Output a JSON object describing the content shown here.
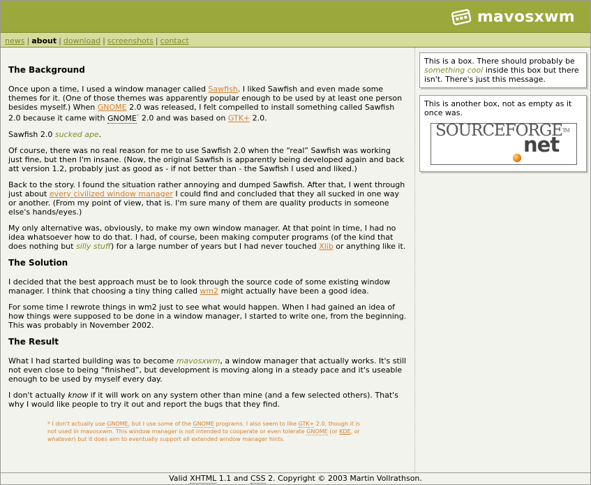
{
  "brand": {
    "name": "mavosxwm"
  },
  "nav": {
    "items": [
      {
        "label": "news"
      },
      {
        "label": "about"
      },
      {
        "label": "download"
      },
      {
        "label": "screenshots"
      },
      {
        "label": "contact"
      }
    ],
    "separator": "|"
  },
  "content": {
    "h_background": "The Background",
    "p1": {
      "t1": "Once upon a time, I used a window manager called ",
      "link_sawfish": "Sawfish",
      "t2": ". I liked Sawfish and even made some themes for it. (One of those themes was apparently popular enough to be used by at least one person besides myself.) When ",
      "link_gnome": "GNOME",
      "t3": " 2.0 was released, I felt compelled to install something called Sawfish 2.0 because it came with ",
      "abbr_gnome": "GNOME",
      "sup": "*",
      "t4": " 2.0 and was based on ",
      "link_gtk": "GTK+",
      "t5": " 2.0."
    },
    "p2": {
      "t1": "Sawfish 2.0 ",
      "em": "sucked ape",
      "t2": "."
    },
    "p3": "Of course, there was no real reason for me to use Sawfish 2.0 when the “real” Sawfish was working just fine, but then I'm insane. (Now, the original Sawfish is apparently being developed again and back att version 1.2, probably just as good as - if not better than - the Sawfish I used and liked.)",
    "p4": {
      "t1": "Back to the story. I found the situation rather annoying and dumped Sawfish. After that, I went through just about ",
      "link": "every civilized window manager",
      "t2": " I could find and concluded that they all sucked in one way or another. (From my point of view, that is. I'm sure many of them are quality products in someone else's hands/eyes.)"
    },
    "p5": {
      "t1": "My only alternative was, obviously, to make my own window manager. At that point in time, I had no idea whatsoever how to do that. I had, of course, been making computer programs (of the kind that does nothing but ",
      "em": "silly stuff",
      "t2": ") for a large number of years but I had never touched ",
      "link": "Xlib",
      "t3": " or anything like it."
    },
    "h_solution": "The Solution",
    "p6": {
      "t1": "I decided that the best approach must be to look through the source code of some existing window manager. I think that choosing a tiny thing called ",
      "link": "wm2",
      "t2": " might actually have been a good idea."
    },
    "p7": "For some time I rewrote things in wm2 just to see what would happen. When I had gained an idea of how things were supposed to be done in a window manager, I started to write one, from the beginning. This was probably in November 2002.",
    "h_result": "The Result",
    "p8": {
      "t1": "What I had started building was to become ",
      "em": "mavosxwm",
      "t2": ", a window manager that actually works. It's still not even close to being “finished”, but development is moving along in a steady pace and it's useable enough to be used by myself every day."
    },
    "p9": {
      "t1": "I don't actually ",
      "em": "know",
      "t2": " if it will work on any system other than mine (and a few selected others). That's why I would like people to try it out and report the bugs that they find."
    },
    "footnote": {
      "t1": "* I don't actually ",
      "em1": "use",
      "t2": " ",
      "gnome1": "GNOME",
      "t3": ", but I use some of the ",
      "gnome2": "GNOME",
      "t4": " programs. I also seem to like ",
      "gtk": "GTK+",
      "t5": " 2.0, though it is not used in mavosxwm. This window manager is not intended to cooperate or even tolerate ",
      "gnome3": "GNOME",
      "t6": " (or ",
      "kde": "KDE",
      "t7": ", or ",
      "em2": "whatever",
      "t8": ") but it does aim to eventually support all extended window manager hints."
    }
  },
  "sidebar": {
    "box1": {
      "t1": "This is a box. There should probably be ",
      "em": "something cool",
      "t2": " inside this box but there isn't. There's just this message."
    },
    "box2": {
      "text": "This is another box, not as empty as it once was."
    },
    "sourceforge": {
      "top": "SOURCEFORGE",
      "tm": "TM",
      "net": "net"
    }
  },
  "footer": {
    "t1": "Valid ",
    "xhtml": "XHTML",
    "t2": " 1.1 and ",
    "css": "CSS",
    "t3": " 2. Copyright © 2003 Martin Vollrathson."
  },
  "colors": {
    "header": "#9aa83c",
    "nav": "#d5dc9d",
    "link": "#d4822f",
    "green_text": "#7d8a2a",
    "page": "#f3f3ed"
  }
}
